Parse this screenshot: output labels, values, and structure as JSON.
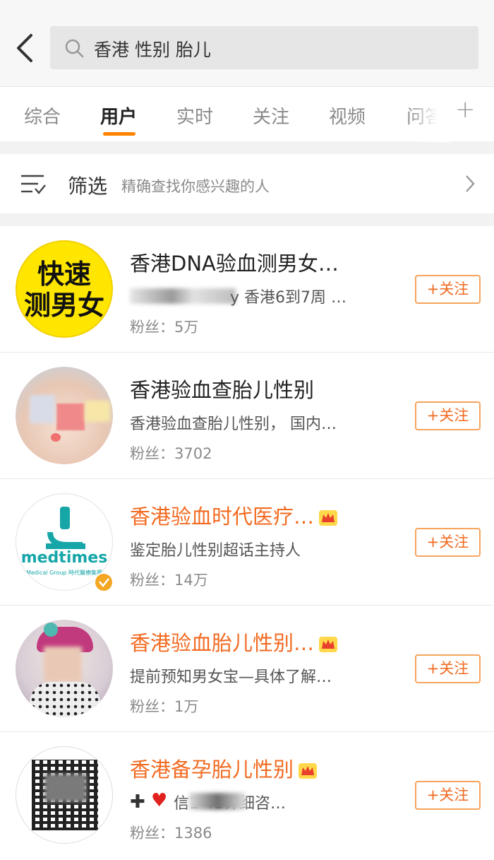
{
  "search": {
    "query": "香港 性别 胎儿"
  },
  "tabs": [
    {
      "label": "综合"
    },
    {
      "label": "用户"
    },
    {
      "label": "实时"
    },
    {
      "label": "关注"
    },
    {
      "label": "视频"
    },
    {
      "label": "问答"
    }
  ],
  "filter": {
    "title": "筛选",
    "description": "精确查找你感兴趣的人"
  },
  "avatar_texts": {
    "u1_line1": "快速",
    "u1_line2": "测男女",
    "u3_brand": "medtimes",
    "u3_sub": "Medical Group 時代醫療集團"
  },
  "users": [
    {
      "name": "香港DNA验血测男女…",
      "desc": "y 香港6到7周 …",
      "fans": "粉丝：5万",
      "follow": "+关注"
    },
    {
      "name": "香港验血查胎儿性别",
      "desc": "香港验血查胎儿性别， 国内…",
      "fans": "粉丝：3702",
      "follow": "+关注"
    },
    {
      "name": "香港验血时代医疗…",
      "desc": "鉴定胎儿性别超话主持人",
      "fans": "粉丝：14万",
      "follow": "+关注"
    },
    {
      "name": "香港验血胎儿性别…",
      "desc": "提前预知男女宝—具体了解…",
      "fans": "粉丝：1万",
      "follow": "+关注"
    },
    {
      "name": "香港备孕胎儿性别",
      "desc": "信1 41详细咨…",
      "fans": "粉丝：1386",
      "follow": "+关注"
    }
  ],
  "colors": {
    "accent": "#ff8200",
    "name_vip": "#f26a20",
    "follow_border": "#f7a35c"
  }
}
